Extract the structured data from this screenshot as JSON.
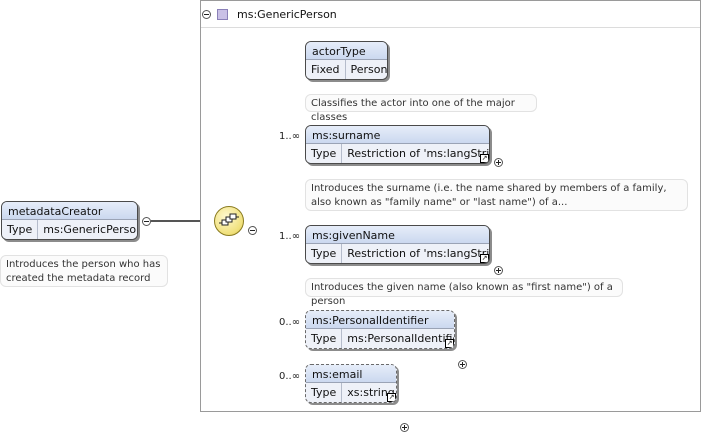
{
  "root_element": {
    "name": "metadataCreator",
    "type_label": "Type",
    "type_value": "ms:GenericPerson",
    "annotation": "Introduces the person who has created the metadata record"
  },
  "container": {
    "type_name": "ms:GenericPerson"
  },
  "children": [
    {
      "name": "actorType",
      "row_label": "Fixed",
      "row_value": "Person",
      "occurrence": "",
      "annotation": "Classifies the actor into one of the major classes"
    },
    {
      "name": "ms:surname",
      "row_label": "Type",
      "row_value": "Restriction of 'ms:langString'",
      "occurrence": "1..∞",
      "annotation": "Introduces the surname (i.e. the name shared by members of a family, also known as \"family name\" or \"last name\") of a..."
    },
    {
      "name": "ms:givenName",
      "row_label": "Type",
      "row_value": "Restriction of 'ms:langString'",
      "occurrence": "1..∞",
      "annotation": "Introduces the given name (also known as \"first name\") of a person"
    },
    {
      "name": "ms:PersonalIdentifier",
      "row_label": "Type",
      "row_value": "ms:PersonalIdentifier",
      "occurrence": "0..∞",
      "annotation": ""
    },
    {
      "name": "ms:email",
      "row_label": "Type",
      "row_value": "xs:string",
      "occurrence": "0..∞",
      "annotation": ""
    }
  ]
}
